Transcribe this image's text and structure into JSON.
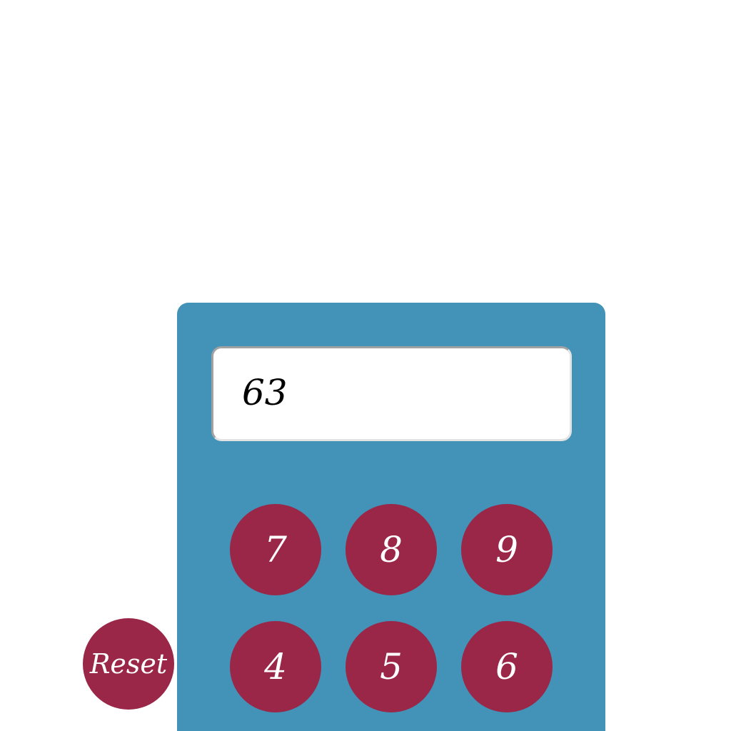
{
  "display": {
    "value": "63"
  },
  "keys": {
    "row1": [
      "7",
      "8",
      "9"
    ],
    "row2": [
      "4",
      "5",
      "6"
    ]
  },
  "reset": {
    "label": "Reset"
  },
  "colors": {
    "calculator_body": "#4293b7",
    "key_fill": "#9a2748",
    "display_background": "#ffffff",
    "page_background": "#ffffff"
  }
}
